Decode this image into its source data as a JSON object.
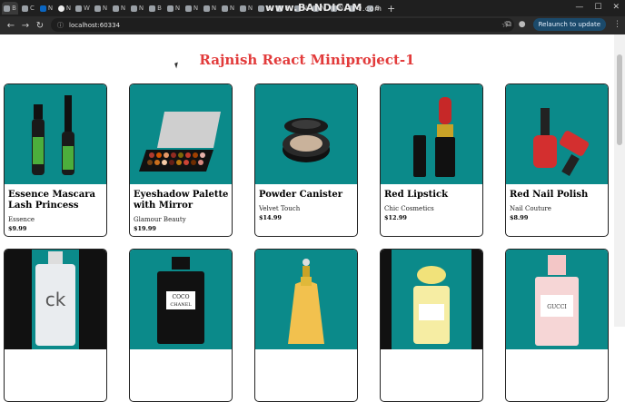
{
  "browser": {
    "tabs": [
      "B",
      "C",
      "N",
      "N",
      "W",
      "N",
      "N",
      "N",
      "B",
      "N",
      "N",
      "N",
      "N",
      "N",
      "N",
      "P",
      "N",
      "N",
      "N",
      "D",
      "B"
    ],
    "watermark": "www.BANDICAM",
    "watermark_suffix": ".com",
    "url": "localhost:60334",
    "relaunch_label": "Relaunch to update"
  },
  "page": {
    "title": "Rajnish React Miniproject-1"
  },
  "products": [
    {
      "name": "Essence Mascara Lash Princess",
      "brand": "Essence",
      "price": "$9.99",
      "image_icon": "mascara-icon"
    },
    {
      "name": "Eyeshadow Palette with Mirror",
      "brand": "Glamour Beauty",
      "price": "$19.99",
      "image_icon": "eyeshadow-palette-icon"
    },
    {
      "name": "Powder Canister",
      "brand": "Velvet Touch",
      "price": "$14.99",
      "image_icon": "powder-canister-icon"
    },
    {
      "name": "Red Lipstick",
      "brand": "Chic Cosmetics",
      "price": "$12.99",
      "image_icon": "lipstick-icon"
    },
    {
      "name": "Red Nail Polish",
      "brand": "Nail Couture",
      "price": "$8.99",
      "image_icon": "nail-polish-icon"
    }
  ],
  "products_row2": [
    {
      "image_icon": "ck-perfume-icon",
      "label": "ck"
    },
    {
      "image_icon": "coco-chanel-perfume-icon",
      "label": "COCO",
      "label2": "CHANEL"
    },
    {
      "image_icon": "dior-perfume-icon"
    },
    {
      "image_icon": "dolce-perfume-icon"
    },
    {
      "image_icon": "gucci-perfume-icon",
      "label": "GUCCI"
    }
  ],
  "colors": {
    "title": "#e23b3b",
    "card_bg": "#0b8a8a"
  }
}
